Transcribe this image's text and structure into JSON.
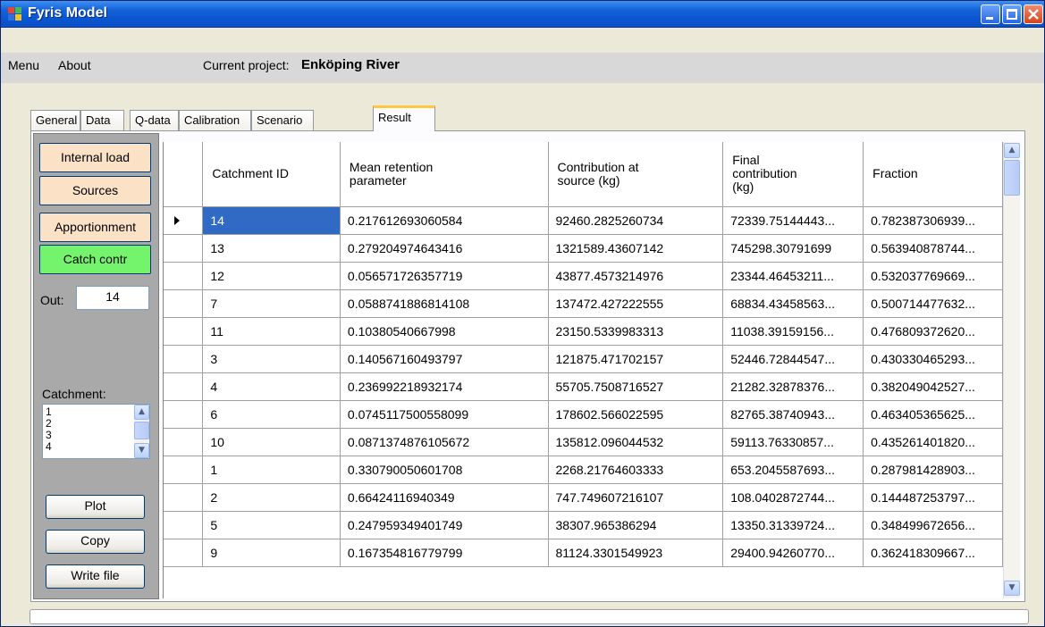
{
  "window": {
    "title": "Fyris Model"
  },
  "menu": {
    "items": [
      "Menu",
      "About"
    ],
    "project_label": "Current project:",
    "project_name": "Enköping River"
  },
  "tabs": [
    "General",
    "Data",
    "Q-data",
    "Calibration",
    "Scenario",
    "Result"
  ],
  "active_tab": "Result",
  "left_panel": {
    "buttons": [
      "Internal load",
      "Sources",
      "Apportionment",
      "Catch contr"
    ],
    "active_button": "Catch contr",
    "out_label": "Out:",
    "out_value": "14",
    "catchment_label": "Catchment:",
    "catchment_items": [
      "1",
      "2",
      "3",
      "4"
    ],
    "action_buttons": [
      "Plot",
      "Copy",
      "Write file"
    ]
  },
  "grid": {
    "columns": [
      "Catchment ID",
      "Mean retention parameter",
      "Contribution at source (kg)",
      "Final contribution (kg)",
      "Fraction"
    ],
    "rows": [
      [
        "14",
        "0.217612693060584",
        "92460.2825260734",
        "72339.75144443...",
        "0.782387306939..."
      ],
      [
        "13",
        "0.279204974643416",
        "1321589.43607142",
        "745298.30791699",
        "0.563940878744..."
      ],
      [
        "12",
        "0.056571726357719",
        "43877.4573214976",
        "23344.46453211...",
        "0.532037769669..."
      ],
      [
        "7",
        "0.0588741886814108",
        "137472.427222555",
        "68834.43458563...",
        "0.500714477632..."
      ],
      [
        "11",
        "0.10380540667998",
        "23150.5339983313",
        "11038.39159156...",
        "0.476809372620..."
      ],
      [
        "3",
        "0.140567160493797",
        "121875.471702157",
        "52446.72844547...",
        "0.430330465293..."
      ],
      [
        "4",
        "0.236992218932174",
        "55705.7508716527",
        "21282.32878376...",
        "0.382049042527..."
      ],
      [
        "6",
        "0.0745117500558099",
        "178602.566022595",
        "82765.38740943...",
        "0.463405365625..."
      ],
      [
        "10",
        "0.0871374876105672",
        "135812.096044532",
        "59113.76330857...",
        "0.435261401820..."
      ],
      [
        "1",
        "0.330790050601708",
        "2268.21764603333",
        "653.2045587693...",
        "0.287981428903..."
      ],
      [
        "2",
        "0.66424116940349",
        "747.749607216107",
        "108.0402872744...",
        "0.144487253797..."
      ],
      [
        "5",
        "0.247959349401749",
        "38307.965386294",
        "13350.31339724...",
        "0.348499672656..."
      ],
      [
        "9",
        "0.167354816779799",
        "81124.3301549923",
        "29400.94260770...",
        "0.362418309667..."
      ]
    ],
    "selected_row": 0
  },
  "colors": {
    "titlebar": "#0a55d0",
    "button_peach": "#fbe2c7",
    "button_green": "#74f36c",
    "selection": "#316ac5",
    "panel_gray": "#a9a9a9"
  }
}
